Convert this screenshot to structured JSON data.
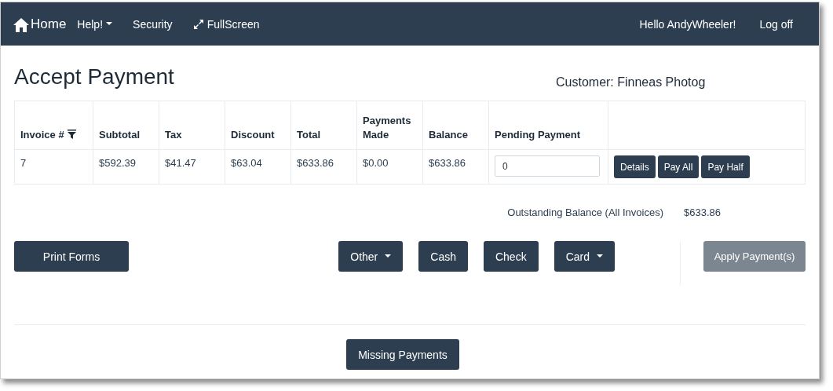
{
  "navbar": {
    "brand": "Home",
    "items": [
      {
        "label": "Help!",
        "kind": "dropdown"
      },
      {
        "label": "Security",
        "kind": "link"
      },
      {
        "label": "FullScreen",
        "kind": "fullscreen"
      }
    ],
    "greeting": "Hello AndyWheeler!",
    "logoff": "Log off"
  },
  "page_title": "Accept Payment",
  "customer": "Customer: Finneas Photog",
  "table": {
    "columns": [
      {
        "label": "Invoice #",
        "kind": "filter"
      },
      {
        "label": "Subtotal",
        "kind": "plain"
      },
      {
        "label": "Tax",
        "kind": "plain"
      },
      {
        "label": "Discount",
        "kind": "plain"
      },
      {
        "label": "Total",
        "kind": "plain"
      },
      {
        "label": "Payments Made",
        "kind": "plain"
      },
      {
        "label": "Balance",
        "kind": "plain"
      },
      {
        "label": "Pending Payment",
        "kind": "plain"
      }
    ],
    "rows": [
      {
        "cells": [
          "7",
          "$592.39",
          "$41.47",
          "$63.04",
          "$633.86",
          "$0.00",
          "$633.86"
        ],
        "pending_payment": "0",
        "actions": [
          "Details",
          "Pay All",
          "Pay Half"
        ]
      }
    ]
  },
  "outstanding": {
    "label": "Outstanding Balance (All Invoices)",
    "value": "$633.86"
  },
  "print_button": "Print Forms",
  "payment_methods": [
    {
      "label": "Other",
      "kind": "dropdown"
    },
    {
      "label": "Cash",
      "kind": "plain"
    },
    {
      "label": "Check",
      "kind": "plain"
    },
    {
      "label": "Card",
      "kind": "dropdown"
    }
  ],
  "apply_button": {
    "label": "Apply Payment(s)",
    "disabled": true
  },
  "footer_button": "Missing Payments"
}
